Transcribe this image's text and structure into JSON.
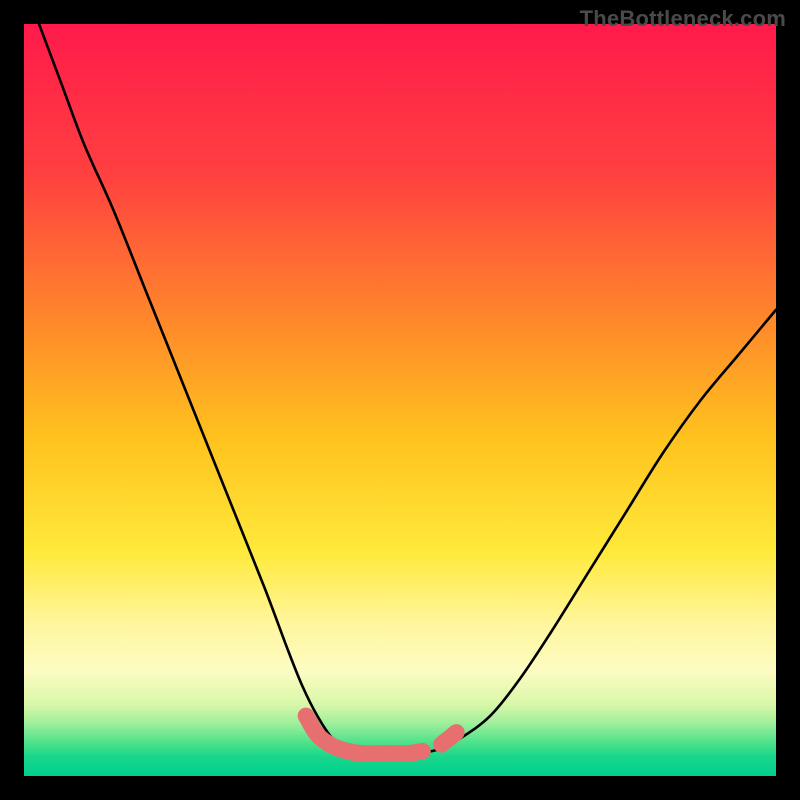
{
  "watermark": {
    "text": "TheBottleneck.com"
  },
  "chart_data": {
    "type": "line",
    "title": "",
    "xlabel": "",
    "ylabel": "",
    "xlim": [
      0,
      100
    ],
    "ylim": [
      0,
      100
    ],
    "grid": false,
    "legend": false,
    "background_gradient": {
      "stops": [
        {
          "pos": 0.0,
          "color": "#ff1a4b"
        },
        {
          "pos": 0.2,
          "color": "#ff4040"
        },
        {
          "pos": 0.4,
          "color": "#ff8a2a"
        },
        {
          "pos": 0.55,
          "color": "#ffc21e"
        },
        {
          "pos": 0.7,
          "color": "#ffe93a"
        },
        {
          "pos": 0.8,
          "color": "#fff6a0"
        },
        {
          "pos": 0.86,
          "color": "#fdfcc2"
        },
        {
          "pos": 0.905,
          "color": "#d8f7a8"
        },
        {
          "pos": 0.93,
          "color": "#9fef9c"
        },
        {
          "pos": 0.955,
          "color": "#4fe28a"
        },
        {
          "pos": 0.975,
          "color": "#17d68b"
        },
        {
          "pos": 1.0,
          "color": "#00cf8e"
        }
      ]
    },
    "series": [
      {
        "name": "bottleneck-curve",
        "color": "#000000",
        "x": [
          2,
          5,
          8,
          12,
          16,
          20,
          24,
          28,
          32,
          35,
          37,
          39,
          41,
          43,
          45,
          48,
          52,
          55,
          58,
          62,
          66,
          70,
          75,
          80,
          85,
          90,
          95,
          100
        ],
        "y": [
          100,
          92,
          84,
          75,
          65,
          55,
          45,
          35,
          25,
          17,
          12,
          8,
          5,
          3.5,
          3,
          3,
          3,
          3.5,
          5,
          8,
          13,
          19,
          27,
          35,
          43,
          50,
          56,
          62
        ]
      }
    ],
    "highlight_segments": [
      {
        "name": "flat-bottom-left",
        "color": "#e76f6f",
        "x": [
          37.5,
          39,
          41,
          43,
          45,
          48,
          51,
          53
        ],
        "y": [
          8,
          5.5,
          4,
          3.3,
          3,
          3,
          3,
          3.3
        ]
      },
      {
        "name": "flat-bottom-right-dot",
        "color": "#e76f6f",
        "x": [
          55.5,
          57.5
        ],
        "y": [
          4.2,
          5.8
        ]
      }
    ]
  }
}
